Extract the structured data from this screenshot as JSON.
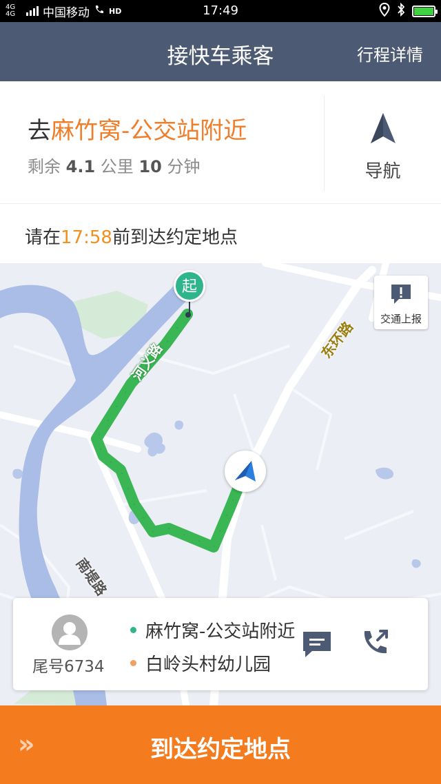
{
  "status_bar": {
    "network": "4G 4G",
    "carrier": "中国移动",
    "hd": "HD",
    "time": "17:49"
  },
  "header": {
    "title": "接快车乘客",
    "right_action": "行程详情"
  },
  "destination": {
    "prefix": "去",
    "place": "麻竹窝-公交站附近",
    "remaining_prefix": "剩余",
    "distance_value": "4.1",
    "distance_unit": "公里",
    "time_value": "10",
    "time_unit": "分钟",
    "nav_label": "导航"
  },
  "deadline": {
    "prefix": "请在",
    "time": "17:58",
    "suffix": "前到达约定地点"
  },
  "map": {
    "start_label": "起",
    "roads": {
      "heyi": "河义路",
      "donghuan": "东环路",
      "nandi": "南堤路"
    },
    "report_label": "交通上报"
  },
  "passenger": {
    "tail_number": "尾号6734",
    "from": "麻竹窝-公交站附近",
    "to": "白岭头村幼儿园"
  },
  "bottom": {
    "chevrons": "»",
    "action_label": "到达约定地点"
  },
  "colors": {
    "header_bg": "#4d5a73",
    "accent_orange": "#f07d2a",
    "button_orange": "#f57b1f",
    "route_green": "#3ab655",
    "start_pin": "#2fb58b",
    "river": "#a9bde6"
  }
}
